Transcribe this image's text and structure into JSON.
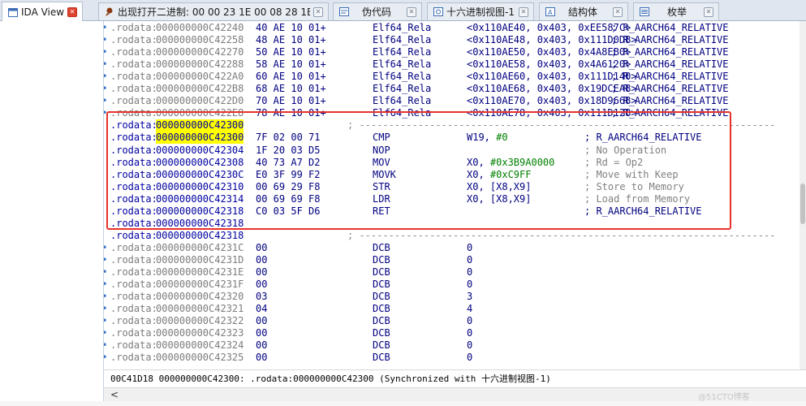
{
  "tabs": [
    {
      "label": "IDA View-A",
      "icon": "ida-view-icon",
      "active": true
    },
    {
      "label": "出现打开二进制: 00 00 23 1E 00 08 28 1E",
      "icon": "pin-icon",
      "active": false
    },
    {
      "label": "伪代码",
      "icon": "pseudocode-icon",
      "active": false
    },
    {
      "label": "十六进制视图-1",
      "icon": "hex-view-icon",
      "active": false
    },
    {
      "label": "结构体",
      "icon": "structures-icon",
      "active": false
    },
    {
      "label": "枚举",
      "icon": "enums-icon",
      "active": false
    }
  ],
  "listing": {
    "rows": [
      {
        "dot": "•",
        "seg": ".rodata:",
        "addr": "000000000C42240",
        "bytes": "40 AE 10 01+",
        "mnem": "Elf64_Rela",
        "ops": "<0x110AE40, 0x403, 0xEE587C>",
        "cmt": "; R_AARCH64_RELATIVE"
      },
      {
        "dot": "•",
        "seg": ".rodata:",
        "addr": "000000000C42258",
        "bytes": "48 AE 10 01+",
        "mnem": "Elf64_Rela",
        "ops": "<0x110AE48, 0x403, 0x111D0D8>",
        "cmt": "; R_AARCH64_RELATIVE"
      },
      {
        "dot": "•",
        "seg": ".rodata:",
        "addr": "000000000C42270",
        "bytes": "50 AE 10 01+",
        "mnem": "Elf64_Rela",
        "ops": "<0x110AE50, 0x403, 0x4A8EB0>",
        "cmt": "; R_AARCH64_RELATIVE"
      },
      {
        "dot": "•",
        "seg": ".rodata:",
        "addr": "000000000C42288",
        "bytes": "58 AE 10 01+",
        "mnem": "Elf64_Rela",
        "ops": "<0x110AE58, 0x403, 0x4A6120>",
        "cmt": "; R_AARCH64_RELATIVE"
      },
      {
        "dot": "•",
        "seg": ".rodata:",
        "addr": "000000000C422A0",
        "bytes": "60 AE 10 01+",
        "mnem": "Elf64_Rela",
        "ops": "<0x110AE60, 0x403, 0x111D140>",
        "cmt": "; R_AARCH64_RELATIVE"
      },
      {
        "dot": "•",
        "seg": ".rodata:",
        "addr": "000000000C422B8",
        "bytes": "68 AE 10 01+",
        "mnem": "Elf64_Rela",
        "ops": "<0x110AE68, 0x403, 0x19DCEA8>",
        "cmt": "; R_AARCH64_RELATIVE"
      },
      {
        "dot": "•",
        "seg": ".rodata:",
        "addr": "000000000C422D0",
        "bytes": "70 AE 10 01+",
        "mnem": "Elf64_Rela",
        "ops": "<0x110AE70, 0x403, 0x18D9668>",
        "cmt": "; R_AARCH64_RELATIVE"
      },
      {
        "dot": "•",
        "seg": ".rodata:",
        "addr": "000000000C422E8",
        "bytes": "78 AE 10 01+",
        "mnem": "Elf64_Rela",
        "ops": "<0x110AE78, 0x403, 0x111D128>",
        "cmt": "; R_AARCH64_RELATIVE"
      },
      {
        "dot": "",
        "seg": ".rodata:",
        "addr": "000000000C42300",
        "bytes": "",
        "mnem": "",
        "ops": "",
        "cmt": "; -----------------------------------------------------------------------"
      },
      {
        "dot": "",
        "seg": ".rodata:",
        "addr": "000000000C42300",
        "bytes": "7F 02 00 71",
        "mnem": "CMP",
        "ops": "W19, #0",
        "cmt": "; R_AARCH64_RELATIVE"
      },
      {
        "dot": "",
        "seg": ".rodata:",
        "addr": "000000000C42304",
        "bytes": "1F 20 03 D5",
        "mnem": "NOP",
        "ops": "",
        "cmt": "; No Operation"
      },
      {
        "dot": "",
        "seg": ".rodata:",
        "addr": "000000000C42308",
        "bytes": "40 73 A7 D2",
        "mnem": "MOV",
        "ops": "X0, #0x3B9A0000",
        "cmt": "; Rd = Op2"
      },
      {
        "dot": "",
        "seg": ".rodata:",
        "addr": "000000000C4230C",
        "bytes": "E0 3F 99 F2",
        "mnem": "MOVK",
        "ops": "X0, #0xC9FF",
        "cmt": "; Move with Keep"
      },
      {
        "dot": "",
        "seg": ".rodata:",
        "addr": "000000000C42310",
        "bytes": "00 69 29 F8",
        "mnem": "STR",
        "ops": "X0, [X8,X9]",
        "cmt": "; Store to Memory"
      },
      {
        "dot": "",
        "seg": ".rodata:",
        "addr": "000000000C42314",
        "bytes": "00 69 69 F8",
        "mnem": "LDR",
        "ops": "X0, [X8,X9]",
        "cmt": "; Load from Memory"
      },
      {
        "dot": "",
        "seg": ".rodata:",
        "addr": "000000000C42318",
        "bytes": "C0 03 5F D6",
        "mnem": "RET",
        "ops": "",
        "cmt": "; R_AARCH64_RELATIVE"
      },
      {
        "dot": "",
        "seg": ".rodata:",
        "addr": "000000000C42318",
        "bytes": "",
        "mnem": "",
        "ops": "",
        "cmt": ""
      },
      {
        "dot": "",
        "seg": ".rodata:",
        "addr": "000000000C42318",
        "bytes": "",
        "mnem": "",
        "ops": "",
        "cmt": "; -----------------------------------------------------------------------"
      },
      {
        "dot": "•",
        "seg": ".rodata:",
        "addr": "000000000C4231C",
        "bytes": "00",
        "mnem": "DCB",
        "ops": "0",
        "cmt": ""
      },
      {
        "dot": "•",
        "seg": ".rodata:",
        "addr": "000000000C4231D",
        "bytes": "00",
        "mnem": "DCB",
        "ops": "0",
        "cmt": ""
      },
      {
        "dot": "•",
        "seg": ".rodata:",
        "addr": "000000000C4231E",
        "bytes": "00",
        "mnem": "DCB",
        "ops": "0",
        "cmt": ""
      },
      {
        "dot": "•",
        "seg": ".rodata:",
        "addr": "000000000C4231F",
        "bytes": "00",
        "mnem": "DCB",
        "ops": "0",
        "cmt": ""
      },
      {
        "dot": "•",
        "seg": ".rodata:",
        "addr": "000000000C42320",
        "bytes": "03",
        "mnem": "DCB",
        "ops": "3",
        "cmt": ""
      },
      {
        "dot": "•",
        "seg": ".rodata:",
        "addr": "000000000C42321",
        "bytes": "04",
        "mnem": "DCB",
        "ops": "4",
        "cmt": ""
      },
      {
        "dot": "•",
        "seg": ".rodata:",
        "addr": "000000000C42322",
        "bytes": "00",
        "mnem": "DCB",
        "ops": "0",
        "cmt": ""
      },
      {
        "dot": "•",
        "seg": ".rodata:",
        "addr": "000000000C42323",
        "bytes": "00",
        "mnem": "DCB",
        "ops": "0",
        "cmt": ""
      },
      {
        "dot": "•",
        "seg": ".rodata:",
        "addr": "000000000C42324",
        "bytes": "00",
        "mnem": "DCB",
        "ops": "0",
        "cmt": ""
      },
      {
        "dot": "•",
        "seg": ".rodata:",
        "addr": "000000000C42325",
        "bytes": "00",
        "mnem": "DCB",
        "ops": "0",
        "cmt": ""
      }
    ]
  },
  "status_line": "00C41D18 000000000C42300: .rodata:000000000C42300 (Synchronized with 十六进制视图-1)",
  "hscroll_arrow": "<",
  "watermark": "@51CTO博客",
  "colors": {
    "highlight_yellow": "#ffff00",
    "annotation_red": "#e8332a",
    "code_blue": "#000080",
    "immediate_green": "#008000",
    "comment_gray": "#808080"
  }
}
